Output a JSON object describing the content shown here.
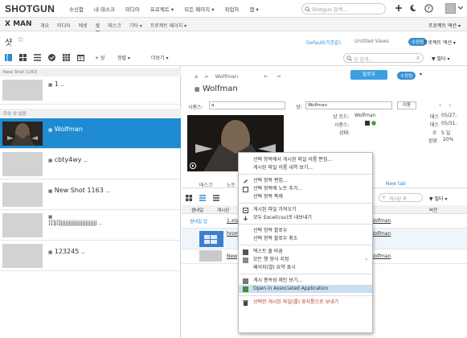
{
  "topbar": {
    "logo": "SHOTGUN",
    "nav": [
      "수신함",
      "내 태스크",
      "미디어",
      "프로젝트 ▾",
      "모든 페이지 ▾",
      "작업자",
      "앱 ▾"
    ],
    "search_placeholder": "Shotgun 검색..."
  },
  "projectbar": {
    "project": "X MAN",
    "tabs": [
      "개요",
      "미디어",
      "에셋",
      "샷",
      "태스크",
      "기타 ▾",
      "프로젝트 페이지 ▾"
    ],
    "active_tab": "샷",
    "project_actions": "프로젝트 액션 ▾"
  },
  "page": {
    "title": "샷",
    "default_label": "Default(기본값)",
    "untitled": "Untitled Views",
    "pill": "수정됨"
  },
  "toolbar": {
    "add": "+ 샷",
    "sort": "정렬 ▾",
    "more": "더보기 ▾",
    "search_placeholder": "샷 검색...",
    "filter": "필터 ▾"
  },
  "list": {
    "group1": "New Shot 1163",
    "group2": "하위 샷 없음",
    "rows": [
      {
        "name": "1",
        "tail": ".."
      },
      {
        "name": "Wolfman",
        "tail": ""
      },
      {
        "name": "cbty4wy",
        "tail": ".."
      },
      {
        "name": "New Shot 1163",
        "tail": ".."
      },
      {
        "name": "]]]j]]jjjjjjjjjjjjjjjjjjjjjjj",
        "tail": ".."
      },
      {
        "name": "123245",
        "tail": ".."
      }
    ]
  },
  "detail": {
    "crumb_a": "a",
    "crumb_sep": ">",
    "crumb_name": "Wolfman",
    "name": "Wolfman",
    "publish_btn": "알로우",
    "pill": "수정됨",
    "seq_label": "시퀀스:",
    "seq_value": "a",
    "shot_label": "샷:",
    "shot_value": "Wolfman",
    "move_btn": "이동",
    "info_labels": [
      "샷 코드:",
      "시퀀스:",
      "상태:"
    ],
    "info_values": [
      "Wolfman",
      "",
      ""
    ],
    "right_labels": [
      "태스",
      "태스",
      "수",
      "완료"
    ],
    "right_values": [
      "05/27,",
      "05/31,",
      "5 일",
      "20%"
    ]
  },
  "subtabs": [
    "태스크",
    "노트",
    "",
    "",
    "",
    "",
    "New tab"
  ],
  "grid": {
    "search_placeholder": "게시된 파..",
    "filter": "필터 ▾",
    "col_thumb": "썸네일",
    "col_pub": "게시된",
    "col_version": "버전",
    "col_wolfman": "Wolfman",
    "rows": [
      {
        "thumb": "썸네일 업",
        "name": "1.xls",
        "link": "Wolfman"
      },
      {
        "thumb": "",
        "name": "hrom",
        "link": "Wolfman"
      },
      {
        "thumb": "",
        "name": "New",
        "link": "Wolfman"
      }
    ]
  },
  "context_menu": {
    "items": [
      "선택 항목에서 게시된 파일 이름 편집...",
      "게시된 파일 이름 내역 보기...",
      "선택 항목 편집...",
      "선택 항목에 노트 추가...",
      "선택 항목 폭제",
      "게시된 파일 가져오기",
      "모두 Excel(csv)로 내보내기",
      "선택 항목 팔로우",
      "선택 항목 팔로우 취소",
      "텍스트 줄 바꿈",
      "모든 행 형식 지정",
      "페이지(열) 요약 표시",
      "게시 종속성 제인 보기...",
      "Open in Associated Application",
      "선택한 게시된 파일(를) 휴지통으로 보내기"
    ],
    "highlighted_index": 13
  }
}
